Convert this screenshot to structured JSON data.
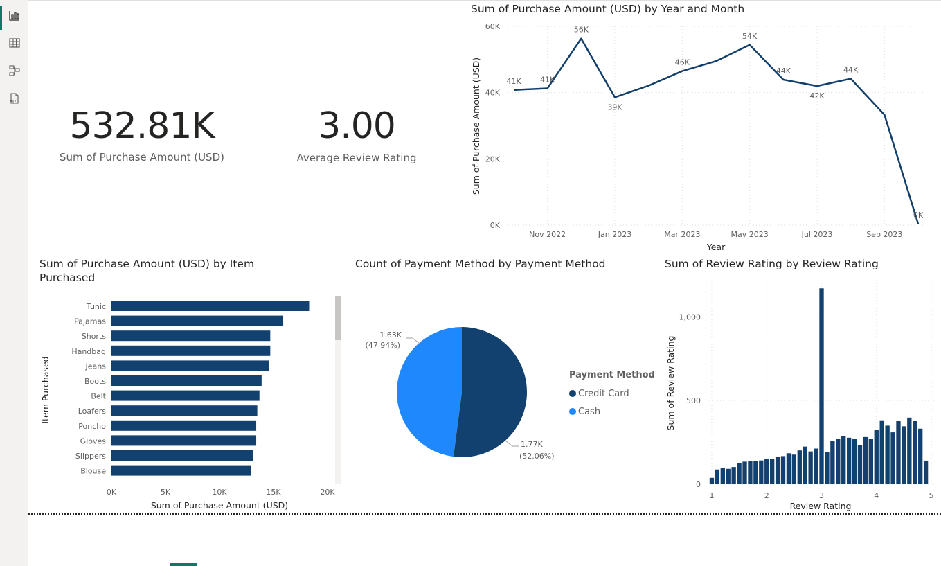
{
  "rail": {
    "items": [
      {
        "name": "report-view-icon",
        "label": "Report"
      },
      {
        "name": "table-view-icon",
        "label": "Table"
      },
      {
        "name": "model-view-icon",
        "label": "Model"
      },
      {
        "name": "dax-query-view-icon",
        "label": "DAX query"
      }
    ]
  },
  "cards": {
    "total_purchase": {
      "value": "532.81K",
      "label": "Sum of Purchase Amount (USD)"
    },
    "avg_rating": {
      "value": "3.00",
      "label": "Average Review Rating"
    }
  },
  "colors": {
    "dark_navy": "#12406f",
    "line_navy": "#123e6b",
    "light_blue": "#1e88fc",
    "accent_green": "#117865"
  },
  "chart_data": [
    {
      "type": "line",
      "title": "Sum of Purchase Amount (USD) by Year and Month",
      "xlabel": "Year",
      "ylabel": "Sum of Purchase Amount (USD)",
      "ylim": [
        0,
        60000
      ],
      "y_ticks": [
        "0K",
        "20K",
        "40K",
        "60K"
      ],
      "x_ticks": [
        "Nov 2022",
        "Jan 2023",
        "Mar 2023",
        "May 2023",
        "Jul 2023",
        "Sep 2023"
      ],
      "x": [
        "Oct 2022",
        "Nov 2022",
        "Dec 2022",
        "Jan 2023",
        "Feb 2023",
        "Mar 2023",
        "Apr 2023",
        "May 2023",
        "Jun 2023",
        "Jul 2023",
        "Aug 2023",
        "Sep 2023",
        "Oct 2023"
      ],
      "values": [
        40800,
        41300,
        56300,
        38600,
        42100,
        46500,
        49500,
        54400,
        43900,
        42000,
        44200,
        33300,
        400
      ],
      "data_labels": [
        "41K",
        "41K",
        "56K",
        "39K",
        "",
        "46K",
        "",
        "54K",
        "44K",
        "42K",
        "44K",
        "",
        "0K"
      ],
      "grid": true
    },
    {
      "type": "bar",
      "orientation": "horizontal",
      "title": "Sum of Purchase Amount (USD) by Item Purchased",
      "xlabel": "Sum of Purchase Amount (USD)",
      "ylabel": "Item Purchased",
      "xlim": [
        0,
        20000
      ],
      "x_ticks": [
        "0K",
        "5K",
        "10K",
        "15K",
        "20K"
      ],
      "categories": [
        "Tunic",
        "Pajamas",
        "Shorts",
        "Handbag",
        "Jeans",
        "Boots",
        "Belt",
        "Loafers",
        "Poncho",
        "Gloves",
        "Slippers",
        "Blouse"
      ],
      "values": [
        18300,
        15900,
        14700,
        14700,
        14600,
        13900,
        13700,
        13500,
        13400,
        13400,
        13100,
        12900
      ]
    },
    {
      "type": "pie",
      "title": "Count of Payment Method by Payment Method",
      "legend_title": "Payment Method",
      "categories": [
        "Credit Card",
        "Cash"
      ],
      "values": [
        1770,
        1630
      ],
      "value_labels": [
        "1.77K",
        "1.63K"
      ],
      "percent_labels": [
        "(52.06%)",
        "(47.94%)"
      ]
    },
    {
      "type": "bar",
      "title": "Sum of Review Rating by Review Rating",
      "xlabel": "Review Rating",
      "ylabel": "Sum of Review Rating",
      "ylim": [
        0,
        1200
      ],
      "y_ticks": [
        "0",
        "500",
        "1,000"
      ],
      "x_ticks": [
        "1",
        "2",
        "3",
        "4",
        "5"
      ],
      "x": [
        1.0,
        1.1,
        1.2,
        1.3,
        1.4,
        1.5,
        1.6,
        1.7,
        1.8,
        1.9,
        2.0,
        2.1,
        2.2,
        2.3,
        2.4,
        2.5,
        2.6,
        2.7,
        2.8,
        2.9,
        3.0,
        3.1,
        3.2,
        3.3,
        3.4,
        3.5,
        3.6,
        3.7,
        3.8,
        3.9,
        4.0,
        4.1,
        4.2,
        4.3,
        4.4,
        4.5,
        4.6,
        4.7,
        4.8,
        4.9,
        5.0
      ],
      "values": [
        38,
        88,
        98,
        92,
        103,
        125,
        135,
        140,
        138,
        142,
        152,
        150,
        163,
        168,
        185,
        177,
        202,
        225,
        196,
        213,
        1170,
        193,
        260,
        270,
        287,
        278,
        270,
        236,
        282,
        272,
        327,
        382,
        350,
        310,
        380,
        346,
        398,
        378,
        332,
        141,
        0
      ]
    }
  ]
}
